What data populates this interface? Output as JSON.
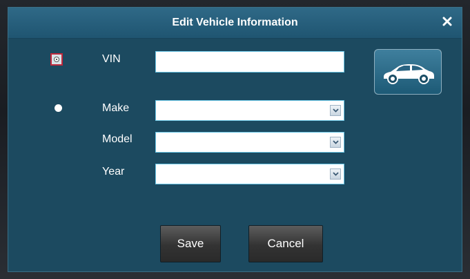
{
  "dialog": {
    "title": "Edit Vehicle Information",
    "close_icon": "close-icon"
  },
  "form": {
    "vin": {
      "label": "VIN",
      "value": "",
      "radio_selected": true
    },
    "make": {
      "label": "Make",
      "value": "",
      "radio_selected": false
    },
    "model": {
      "label": "Model",
      "value": ""
    },
    "year": {
      "label": "Year",
      "value": ""
    }
  },
  "car_button": {
    "icon": "car-icon"
  },
  "buttons": {
    "save_label": "Save",
    "cancel_label": "Cancel"
  },
  "colors": {
    "dialog_bg": "#1c4a60",
    "titlebar": "#2f6987",
    "field_border": "#69c6e6"
  }
}
